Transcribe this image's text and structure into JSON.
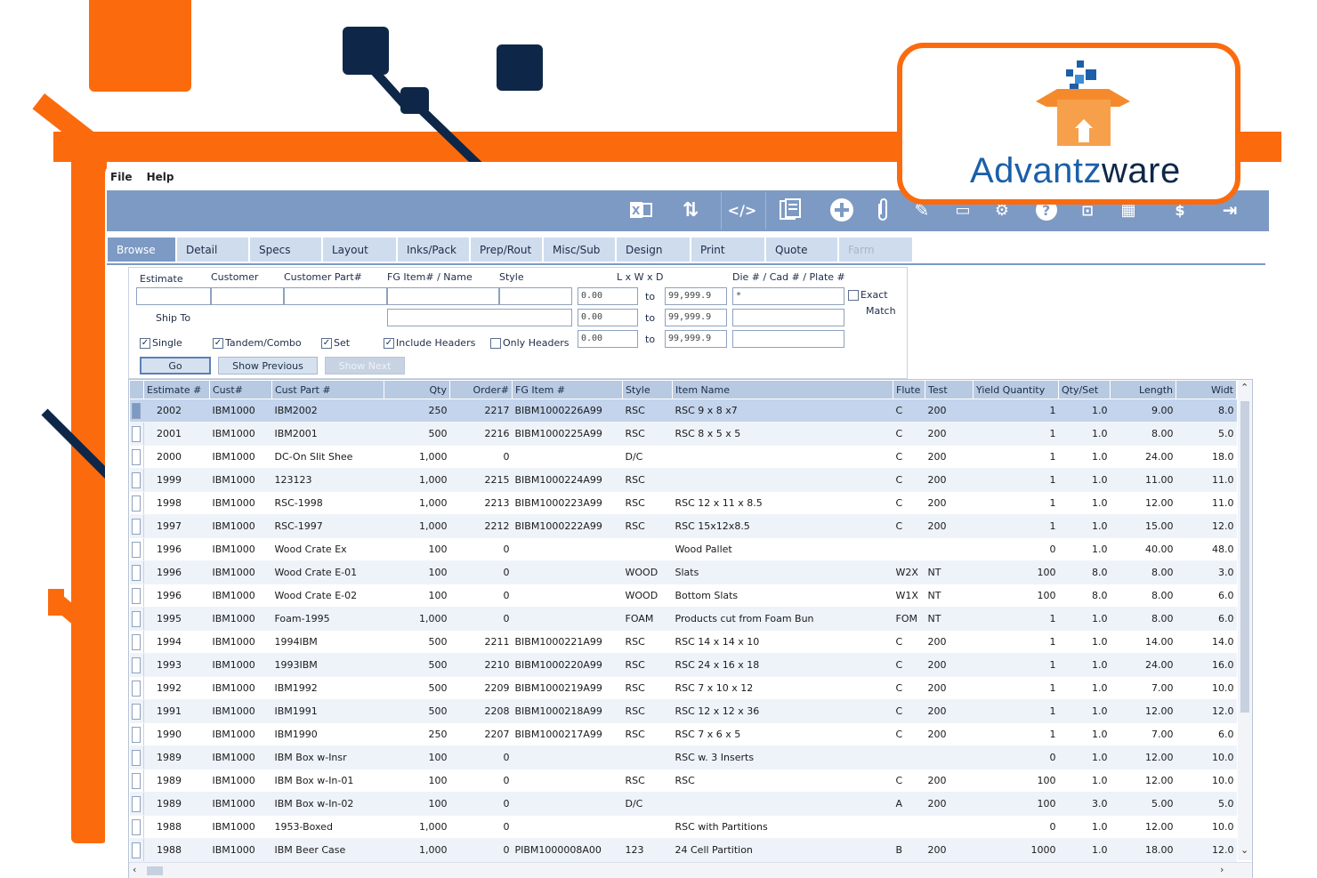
{
  "menu": {
    "file": "File",
    "help": "Help"
  },
  "toolbar_icons": [
    "excel-icon",
    "sort-icon",
    "code-icon",
    "notes-icon",
    "add-icon",
    "attach-icon",
    "edit-icon",
    "view-icon",
    "settings-icon",
    "help-icon",
    "camera-icon",
    "grid-icon",
    "price-icon",
    "exit-icon"
  ],
  "tabs": [
    "Browse",
    "Detail",
    "Specs",
    "Layout",
    "Inks/Pack",
    "Prep/Rout",
    "Misc/Sub",
    "Design",
    "Print",
    "Quote",
    "Farm"
  ],
  "active_tab": "Browse",
  "search": {
    "estimate_label": "Estimate",
    "customer_label": "Customer",
    "customer_part_label": "Customer Part#",
    "fg_item_label": "FG Item# / Name",
    "style_label": "Style",
    "lwd_label": "L x W x D",
    "die_label": "Die # / Cad # / Plate #",
    "ship_to_label": "Ship To",
    "to1": "to",
    "to2": "to",
    "to3": "to",
    "min_l": "0.00",
    "min_w": "0.00",
    "min_d": "0.00",
    "max_l": "99,999.9",
    "max_w": "99,999.9",
    "max_d": "99,999.9",
    "die_value": "*",
    "exact_label": "Exact",
    "match_label": "Match",
    "single_label": "Single",
    "tandem_label": "Tandem/Combo",
    "set_label": "Set",
    "include_headers_label": "Include Headers",
    "only_headers_label": "Only Headers",
    "go_label": "Go",
    "show_previous_label": "Show Previous",
    "show_next_label": "Show Next"
  },
  "grid": {
    "columns": [
      "Estimate #",
      "Cust#",
      "Cust Part #",
      "Qty",
      "Order#",
      "FG Item #",
      "Style",
      "Item Name",
      "Flute",
      "Test",
      "Yield Quantity",
      "Qty/Set",
      "Length",
      "Widt"
    ],
    "rows": [
      [
        "2002",
        "IBM1000",
        "IBM2002",
        "250",
        "2217",
        "BIBM1000226A99",
        "RSC",
        "RSC 9 x 8 x7",
        "C",
        "200",
        "1",
        "1.0",
        "9.00",
        "8.0"
      ],
      [
        "2001",
        "IBM1000",
        "IBM2001",
        "500",
        "2216",
        "BIBM1000225A99",
        "RSC",
        "RSC 8 x 5 x 5",
        "C",
        "200",
        "1",
        "1.0",
        "8.00",
        "5.0"
      ],
      [
        "2000",
        "IBM1000",
        "DC-On Slit Shee",
        "1,000",
        "0",
        "",
        "D/C",
        "",
        "C",
        "200",
        "1",
        "1.0",
        "24.00",
        "18.0"
      ],
      [
        "1999",
        "IBM1000",
        "123123",
        "1,000",
        "2215",
        "BIBM1000224A99",
        "RSC",
        "",
        "C",
        "200",
        "1",
        "1.0",
        "11.00",
        "11.0"
      ],
      [
        "1998",
        "IBM1000",
        "RSC-1998",
        "1,000",
        "2213",
        "BIBM1000223A99",
        "RSC",
        "RSC 12 x 11 x 8.5",
        "C",
        "200",
        "1",
        "1.0",
        "12.00",
        "11.0"
      ],
      [
        "1997",
        "IBM1000",
        "RSC-1997",
        "1,000",
        "2212",
        "BIBM1000222A99",
        "RSC",
        "RSC 15x12x8.5",
        "C",
        "200",
        "1",
        "1.0",
        "15.00",
        "12.0"
      ],
      [
        "1996",
        "IBM1000",
        "Wood Crate Ex",
        "100",
        "0",
        "",
        "",
        "Wood Pallet",
        "",
        "",
        "0",
        "1.0",
        "40.00",
        "48.0"
      ],
      [
        "1996",
        "IBM1000",
        "Wood Crate E-01",
        "100",
        "0",
        "",
        "WOOD",
        "Slats",
        "W2X",
        "NT",
        "100",
        "8.0",
        "8.00",
        "3.0"
      ],
      [
        "1996",
        "IBM1000",
        "Wood Crate E-02",
        "100",
        "0",
        "",
        "WOOD",
        "Bottom Slats",
        "W1X",
        "NT",
        "100",
        "8.0",
        "8.00",
        "6.0"
      ],
      [
        "1995",
        "IBM1000",
        "Foam-1995",
        "1,000",
        "0",
        "",
        "FOAM",
        "Products cut from Foam Bun",
        "FOM",
        "NT",
        "1",
        "1.0",
        "8.00",
        "6.0"
      ],
      [
        "1994",
        "IBM1000",
        "1994IBM",
        "500",
        "2211",
        "BIBM1000221A99",
        "RSC",
        "RSC 14 x 14 x 10",
        "C",
        "200",
        "1",
        "1.0",
        "14.00",
        "14.0"
      ],
      [
        "1993",
        "IBM1000",
        "1993IBM",
        "500",
        "2210",
        "BIBM1000220A99",
        "RSC",
        "RSC 24 x 16 x 18",
        "C",
        "200",
        "1",
        "1.0",
        "24.00",
        "16.0"
      ],
      [
        "1992",
        "IBM1000",
        "IBM1992",
        "500",
        "2209",
        "BIBM1000219A99",
        "RSC",
        "RSC 7 x 10 x 12",
        "C",
        "200",
        "1",
        "1.0",
        "7.00",
        "10.0"
      ],
      [
        "1991",
        "IBM1000",
        "IBM1991",
        "500",
        "2208",
        "BIBM1000218A99",
        "RSC",
        "RSC 12 x 12 x 36",
        "C",
        "200",
        "1",
        "1.0",
        "12.00",
        "12.0"
      ],
      [
        "1990",
        "IBM1000",
        "IBM1990",
        "250",
        "2207",
        "BIBM1000217A99",
        "RSC",
        "RSC 7 x 6 x 5",
        "C",
        "200",
        "1",
        "1.0",
        "7.00",
        "6.0"
      ],
      [
        "1989",
        "IBM1000",
        "IBM Box w-Insr",
        "100",
        "0",
        "",
        "",
        "RSC w. 3 Inserts",
        "",
        "",
        "0",
        "1.0",
        "12.00",
        "10.0"
      ],
      [
        "1989",
        "IBM1000",
        "IBM Box w-In-01",
        "100",
        "0",
        "",
        "RSC",
        "RSC",
        "C",
        "200",
        "100",
        "1.0",
        "12.00",
        "10.0"
      ],
      [
        "1989",
        "IBM1000",
        "IBM Box w-In-02",
        "100",
        "0",
        "",
        "D/C",
        "",
        "A",
        "200",
        "100",
        "3.0",
        "5.00",
        "5.0"
      ],
      [
        "1988",
        "IBM1000",
        "1953-Boxed",
        "1,000",
        "0",
        "",
        "",
        "RSC with Partitions",
        "",
        "",
        "0",
        "1.0",
        "12.00",
        "10.0"
      ],
      [
        "1988",
        "IBM1000",
        "IBM Beer Case",
        "1,000",
        "0",
        "PIBM1000008A00",
        "123",
        "24 Cell Partition",
        "B",
        "200",
        "1000",
        "1.0",
        "18.00",
        "12.0"
      ]
    ]
  },
  "logo": {
    "part1": "Advantz",
    "part2": "ware"
  },
  "colors": {
    "brand_orange": "#fb6b0e",
    "navy": "#0e2748",
    "toolbar_blue": "#7d9ac4",
    "header_blue": "#b8c9e2"
  }
}
